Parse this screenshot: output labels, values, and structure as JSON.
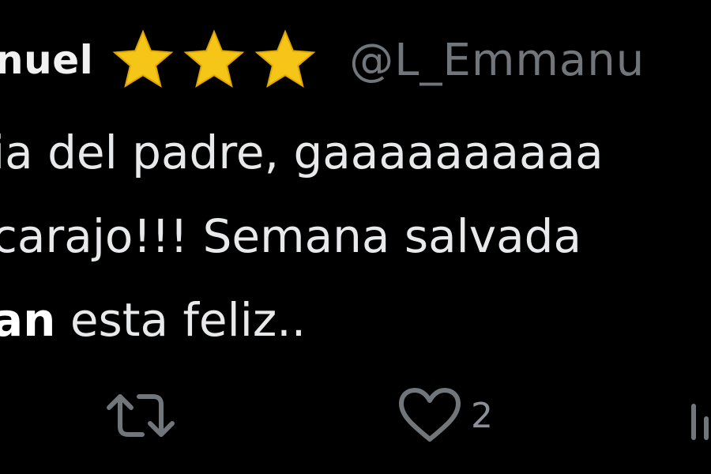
{
  "tweet": {
    "display_name": "nuel",
    "rating_stars": 3,
    "handle": "@L_Emmanu",
    "body_lines": [
      {
        "text": "ia del padre, gaaaaaaaaaa"
      },
      {
        "text": " carajo!!! Semana salvada"
      },
      {
        "mention": "an",
        "text": " esta feliz.."
      }
    ]
  },
  "actions": {
    "retweet": {
      "icon": "retweet-icon"
    },
    "like": {
      "icon": "heart-icon",
      "count": "2"
    },
    "views": {
      "icon": "views-icon"
    }
  },
  "colors": {
    "background": "#000000",
    "text": "#e7e9ea",
    "muted": "#71767b",
    "star": "#f5c518"
  }
}
